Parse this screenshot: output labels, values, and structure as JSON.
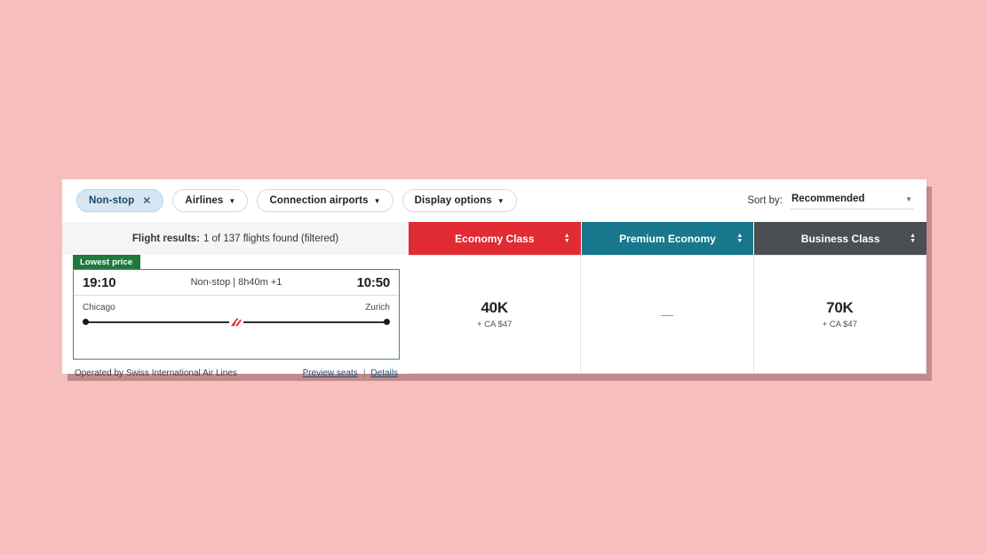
{
  "theme": {
    "page_background": "#f6bebc",
    "economy_color": "#e12b33",
    "premium_color": "#17788d",
    "business_color": "#4a4f54",
    "lowest_price_color": "#1e7a3c",
    "link_color": "#1f4e79"
  },
  "toolbar": {
    "filters": [
      {
        "label": "Non-stop",
        "active": true,
        "icon": "close-icon",
        "icon_glyph": "✕"
      },
      {
        "label": "Airlines",
        "active": false,
        "icon": "chevron-down-icon",
        "icon_glyph": "▼"
      },
      {
        "label": "Connection airports",
        "active": false,
        "icon": "chevron-down-icon",
        "icon_glyph": "▼"
      },
      {
        "label": "Display options",
        "active": false,
        "icon": "chevron-down-icon",
        "icon_glyph": "▼"
      }
    ],
    "sort": {
      "label": "Sort by:",
      "value": "Recommended",
      "caret_glyph": "▼"
    }
  },
  "table": {
    "summary": {
      "title": "Flight results:",
      "detail": "1 of 137 flights found (filtered)"
    },
    "class_columns": [
      {
        "label": "Economy Class",
        "color": "#e12b33",
        "sort_icon": "sort-arrows-icon"
      },
      {
        "label": "Premium Economy",
        "color": "#17788d",
        "sort_icon": "sort-arrows-icon"
      },
      {
        "label": "Business Class",
        "color": "#4a4f54",
        "sort_icon": "sort-arrows-icon"
      }
    ]
  },
  "flight": {
    "badge": "Lowest price",
    "depart_time": "19:10",
    "arrive_time": "10:50",
    "summary": "Non-stop | 8h40m +1",
    "origin_city": "Chicago",
    "destination_city": "Zurich",
    "operated_by": "Operated by Swiss International Air Lines",
    "preview_seats_link": "Preview seats",
    "link_divider": "|",
    "details_link": "Details",
    "airline_logo": "swiss-airlines-logo"
  },
  "prices": [
    {
      "cabin": "Economy Class",
      "points": "40K",
      "cash": "+ CA $47",
      "available": true
    },
    {
      "cabin": "Premium Economy",
      "points": "—",
      "cash": "",
      "available": false
    },
    {
      "cabin": "Business Class",
      "points": "70K",
      "cash": "+ CA $47",
      "available": true
    }
  ]
}
